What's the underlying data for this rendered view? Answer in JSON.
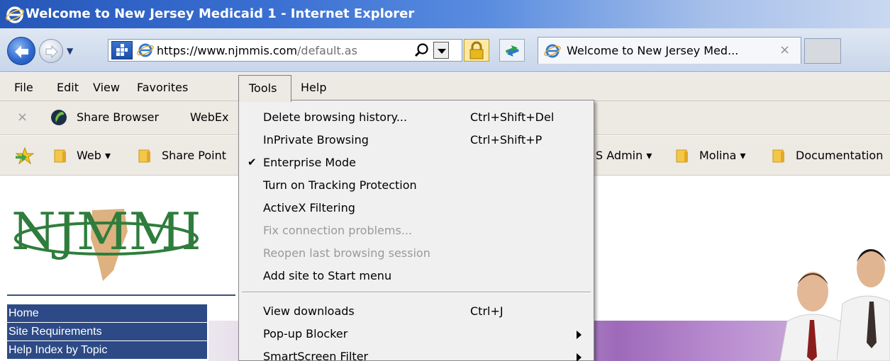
{
  "window": {
    "title": "Welcome to New Jersey Medicaid 1 - Internet Explorer"
  },
  "address_bar": {
    "url_scheme": "https://",
    "url_host": "www.njmmis.com",
    "url_rest": "/default.as"
  },
  "tab": {
    "title": "Welcome to New Jersey Med...",
    "close": "×"
  },
  "menubar": {
    "file": "File",
    "edit": "Edit",
    "view": "View",
    "favorites": "Favorites",
    "tools": "Tools",
    "help": "Help"
  },
  "command_bar": {
    "close": "×",
    "share_browser": "Share Browser",
    "webex": "WebEx"
  },
  "favorites_bar": {
    "items": [
      {
        "label": "Web ▾"
      },
      {
        "label": "Share Point"
      },
      {
        "label": "S Admin ▾"
      },
      {
        "label": "Molina ▾"
      },
      {
        "label": "Documentation"
      }
    ]
  },
  "tools_menu": {
    "items": [
      {
        "label": "Delete browsing history...",
        "shortcut": "Ctrl+Shift+Del",
        "enabled": true
      },
      {
        "label": "InPrivate Browsing",
        "shortcut": "Ctrl+Shift+P",
        "enabled": true
      },
      {
        "label": "Enterprise Mode",
        "shortcut": "",
        "enabled": true,
        "checked": true,
        "check_mark": "✔"
      },
      {
        "label": "Turn on Tracking Protection",
        "shortcut": "",
        "enabled": true
      },
      {
        "label": "ActiveX Filtering",
        "shortcut": "",
        "enabled": true
      },
      {
        "label": "Fix connection problems...",
        "shortcut": "",
        "enabled": false
      },
      {
        "label": "Reopen last browsing session",
        "shortcut": "",
        "enabled": false
      },
      {
        "label": "Add site to Start menu",
        "shortcut": "",
        "enabled": true
      },
      {
        "label": "View downloads",
        "shortcut": "Ctrl+J",
        "enabled": true
      },
      {
        "label": "Pop-up Blocker",
        "shortcut": "",
        "enabled": true,
        "submenu": true
      },
      {
        "label": "SmartScreen Filter",
        "shortcut": "",
        "enabled": true,
        "submenu": true
      }
    ]
  },
  "page": {
    "logo_text": "NJMMIS",
    "left_nav": [
      {
        "label": "Home"
      },
      {
        "label": "Site Requirements"
      },
      {
        "label": "Help Index by Topic"
      }
    ]
  },
  "colors": {
    "title_bar": "#2557b8",
    "nav_background": "#2d4a86",
    "menu_background": "#f0f0f0",
    "logo_green": "#2f7d3c"
  }
}
